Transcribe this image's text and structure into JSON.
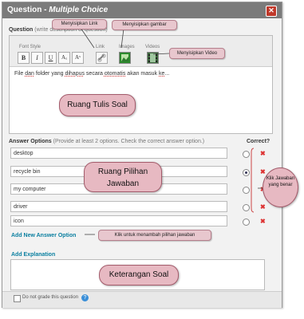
{
  "dialog": {
    "title_prefix": "Question - ",
    "title_type": "Multiple Choice",
    "close_glyph": "✕"
  },
  "question": {
    "label": "Question",
    "hint": "(write description of question)",
    "toolbar": {
      "font_style_label": "Font Style",
      "link_label": "Link",
      "images_label": "Images",
      "videos_label": "Videos",
      "bold": "B",
      "italic": "I",
      "underline": "U",
      "subscript": "Aₓ",
      "superscript": "Aˣ"
    },
    "text_pre": "File ",
    "text_u1": "dan",
    "text_mid1": " folder yang ",
    "text_u2": "dihapus",
    "text_mid2": " secara ",
    "text_u3": "otomatis",
    "text_mid3": " akan masuk ",
    "text_u4": "ke",
    "text_end": "..."
  },
  "answers": {
    "label": "Answer Options",
    "hint": "(Provide at least 2 options. Check the correct answer option.)",
    "correct_label": "Correct?",
    "items": [
      {
        "value": "desktop",
        "correct": false
      },
      {
        "value": "recycle bin",
        "correct": true
      },
      {
        "value": "my computer",
        "correct": false
      },
      {
        "value": "driver",
        "correct": false
      },
      {
        "value": "icon",
        "correct": false
      }
    ],
    "add_option": "Add New Answer Option",
    "delete_glyph": "✖"
  },
  "explanation": {
    "label": "Add Explanation"
  },
  "footer": {
    "no_grade": "Do not grade this question",
    "help_glyph": "?"
  },
  "annotations": {
    "link": "Menyisipkan Link",
    "image": "Menyisipkan gambar",
    "video": "Menyisipkan Video",
    "write_area": "Ruang Tulis Soal",
    "answer_area_1": "Ruang Pilihan",
    "answer_area_2": "Jawaban",
    "add_answer": "Klik untuk menambah pilihan jawaban",
    "explanation": "Keterangan Soal",
    "click_answer": "Klik Jawaban yang benar"
  },
  "colors": {
    "titlebar": "#7b7b7b",
    "link": "#0a7fa0",
    "annotation": "#e7b9c2",
    "delete": "#d33333"
  }
}
